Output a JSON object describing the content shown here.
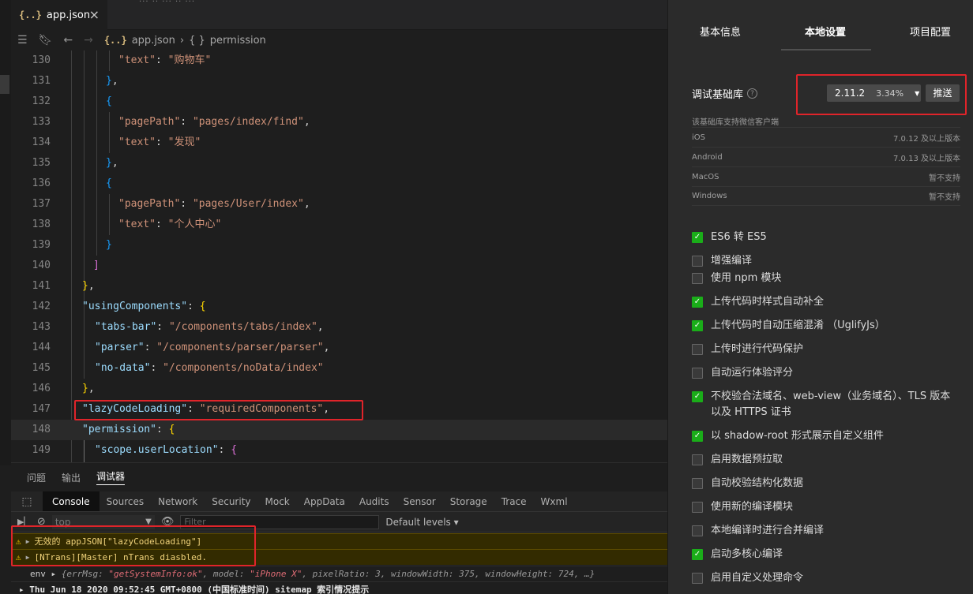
{
  "editor": {
    "tab": {
      "icon": "{..}",
      "label": "app.json",
      "close": "×"
    },
    "top_strip": "··· ·· ··· ·· ···",
    "breadcrumb": {
      "file_icon": "{..}",
      "file": "app.json",
      "separator": "›",
      "obj_icon": "{ }",
      "symbol": "permission"
    },
    "lines": [
      {
        "n": "130",
        "tokens": [
          [
            "t-key2",
            "\"text\""
          ],
          [
            "t-punc",
            ": "
          ],
          [
            "t-str",
            "\"购物车\""
          ]
        ],
        "indent": 136
      },
      {
        "n": "131",
        "tokens": [
          [
            "t-brace-b",
            "}"
          ],
          [
            "t-punc",
            ","
          ]
        ],
        "indent": 120
      },
      {
        "n": "132",
        "tokens": [
          [
            "t-brace-b",
            "{"
          ]
        ],
        "indent": 120
      },
      {
        "n": "133",
        "tokens": [
          [
            "t-key2",
            "\"pagePath\""
          ],
          [
            "t-punc",
            ": "
          ],
          [
            "t-str",
            "\"pages/index/find\""
          ],
          [
            "t-punc",
            ","
          ]
        ],
        "indent": 136
      },
      {
        "n": "134",
        "tokens": [
          [
            "t-key2",
            "\"text\""
          ],
          [
            "t-punc",
            ": "
          ],
          [
            "t-str",
            "\"发现\""
          ]
        ],
        "indent": 136
      },
      {
        "n": "135",
        "tokens": [
          [
            "t-brace-b",
            "}"
          ],
          [
            "t-punc",
            ","
          ]
        ],
        "indent": 120
      },
      {
        "n": "136",
        "tokens": [
          [
            "t-brace-b",
            "{"
          ]
        ],
        "indent": 120
      },
      {
        "n": "137",
        "tokens": [
          [
            "t-key2",
            "\"pagePath\""
          ],
          [
            "t-punc",
            ": "
          ],
          [
            "t-str",
            "\"pages/User/index\""
          ],
          [
            "t-punc",
            ","
          ]
        ],
        "indent": 136
      },
      {
        "n": "138",
        "tokens": [
          [
            "t-key2",
            "\"text\""
          ],
          [
            "t-punc",
            ": "
          ],
          [
            "t-str",
            "\"个人中心\""
          ]
        ],
        "indent": 136
      },
      {
        "n": "139",
        "tokens": [
          [
            "t-brace-b",
            "}"
          ]
        ],
        "indent": 120
      },
      {
        "n": "140",
        "tokens": [
          [
            "t-brace-p",
            "]"
          ]
        ],
        "indent": 104
      },
      {
        "n": "141",
        "tokens": [
          [
            "t-brace-y",
            "}"
          ],
          [
            "t-punc",
            ","
          ]
        ],
        "indent": 90
      },
      {
        "n": "142",
        "tokens": [
          [
            "t-key",
            "\"usingComponents\""
          ],
          [
            "t-punc",
            ": "
          ],
          [
            "t-brace-y",
            "{"
          ]
        ],
        "indent": 90
      },
      {
        "n": "143",
        "tokens": [
          [
            "t-key",
            "\"tabs-bar\""
          ],
          [
            "t-punc",
            ": "
          ],
          [
            "t-str",
            "\"/components/tabs/index\""
          ],
          [
            "t-punc",
            ","
          ]
        ],
        "indent": 106
      },
      {
        "n": "144",
        "tokens": [
          [
            "t-key",
            "\"parser\""
          ],
          [
            "t-punc",
            ": "
          ],
          [
            "t-str",
            "\"/components/parser/parser\""
          ],
          [
            "t-punc",
            ","
          ]
        ],
        "indent": 106
      },
      {
        "n": "145",
        "tokens": [
          [
            "t-key",
            "\"no-data\""
          ],
          [
            "t-punc",
            ": "
          ],
          [
            "t-str",
            "\"/components/noData/index\""
          ]
        ],
        "indent": 106
      },
      {
        "n": "146",
        "tokens": [
          [
            "t-brace-y",
            "}"
          ],
          [
            "t-punc",
            ","
          ]
        ],
        "indent": 90
      },
      {
        "n": "147",
        "tokens": [
          [
            "t-key",
            "\"lazyCodeLoading\""
          ],
          [
            "t-punc",
            ": "
          ],
          [
            "t-str",
            "\"requiredComponents\""
          ],
          [
            "t-punc",
            ","
          ]
        ],
        "indent": 90
      },
      {
        "n": "148",
        "tokens": [
          [
            "t-key",
            "\"permission\""
          ],
          [
            "t-punc",
            ": "
          ],
          [
            "t-brace-y",
            "{"
          ]
        ],
        "indent": 90,
        "active": true
      },
      {
        "n": "149",
        "tokens": [
          [
            "t-key",
            "\"scope.userLocation\""
          ],
          [
            "t-punc",
            ": "
          ],
          [
            "t-brace-p",
            "{"
          ]
        ],
        "indent": 106
      }
    ]
  },
  "panel": {
    "tabs": [
      "问题",
      "输出",
      "调试器"
    ],
    "active_tab": "调试器",
    "devtools_tabs": [
      "Console",
      "Sources",
      "Network",
      "Security",
      "Mock",
      "AppData",
      "Audits",
      "Sensor",
      "Storage",
      "Trace",
      "Wxml"
    ],
    "devtools_active": "Console",
    "toolbar": {
      "context": "top",
      "filter_placeholder": "Filter",
      "levels": "Default levels ▾"
    },
    "warnings": [
      "无效的 appJSON[\"lazyCodeLoading\"]",
      "[NTrans][Master] nTrans diasbled."
    ],
    "log_env": {
      "prefix": "env ▸",
      "text1": "{errMsg: ",
      "s1": "\"getSystemInfo:ok\"",
      "text2": ", model: ",
      "s2": "\"iPhone X\"",
      "text3": ", pixelRatio: 3, windowWidth: 375, windowHeight: 724, …}"
    },
    "log_sitemap": "▸ Thu Jun 18 2020 09:52:45 GMT+0800 (中国标准时间) sitemap 索引情况提示"
  },
  "settings": {
    "tabs": [
      "基本信息",
      "本地设置",
      "项目配置"
    ],
    "active_tab": "本地设置",
    "lib_label": "调试基础库",
    "help": "?",
    "lib_version": "2.11.2",
    "lib_percent": "3.34%",
    "push_label": "推送",
    "support_title": "该基础库支持微信客户端",
    "support": [
      {
        "os": "iOS",
        "v": "7.0.12 及以上版本"
      },
      {
        "os": "Android",
        "v": "7.0.13 及以上版本"
      },
      {
        "os": "MacOS",
        "v": "暂不支持"
      },
      {
        "os": "Windows",
        "v": "暂不支持"
      }
    ],
    "options": [
      {
        "label": "ES6 转 ES5",
        "checked": true
      },
      {
        "label": "增强编译",
        "checked": false
      },
      {
        "label": "使用 npm 模块",
        "checked": false
      },
      {
        "label": "上传代码时样式自动补全",
        "checked": true
      },
      {
        "label": "上传代码时自动压缩混淆 （UglifyJs）",
        "checked": true
      },
      {
        "label": "上传时进行代码保护",
        "checked": false
      },
      {
        "label": "自动运行体验评分",
        "checked": false
      },
      {
        "label": "不校验合法域名、web-view（业务域名）、TLS 版本以及 HTTPS 证书",
        "checked": true
      },
      {
        "label": "以 shadow-root 形式展示自定义组件",
        "checked": true
      },
      {
        "label": "启用数据预拉取",
        "checked": false
      },
      {
        "label": "自动校验结构化数据",
        "checked": false
      },
      {
        "label": "使用新的编译模块",
        "checked": false
      },
      {
        "label": "本地编译时进行合并编译",
        "checked": false
      },
      {
        "label": "启动多核心编译",
        "checked": true
      },
      {
        "label": "启用自定义处理命令",
        "checked": false
      }
    ]
  },
  "colors": {
    "accent_check": "#1aad19",
    "highlight_box": "#e0242a",
    "warning_bg": "#332b00"
  }
}
